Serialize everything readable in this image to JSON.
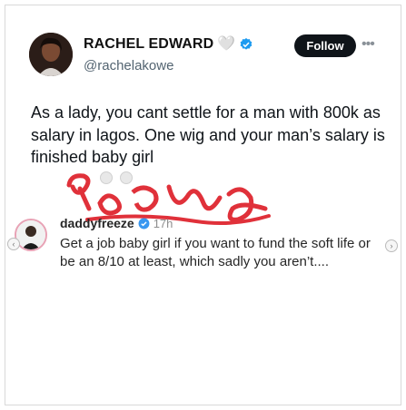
{
  "post": {
    "author_name": "RACHEL EDWARD",
    "name_emoji": "🤍",
    "handle": "@rachelakowe",
    "follow_label": "Follow",
    "more_icon": "more-horizontal-icon",
    "text": "As a lady, you cant settle for a man with 800k as salary in lagos. One wig and your man’s salary is finished baby girl"
  },
  "reply": {
    "username": "daddyfreeze",
    "time": "17h",
    "text": "Get a job baby girl if you want to fund the soft life or be an 8/10 at least, which sadly you aren’t...."
  },
  "colors": {
    "follow_bg": "#0f1419",
    "verified_blue": "#1d9bf0",
    "watermark_red": "#e0313a",
    "story_ring": "#e8a2b5"
  }
}
